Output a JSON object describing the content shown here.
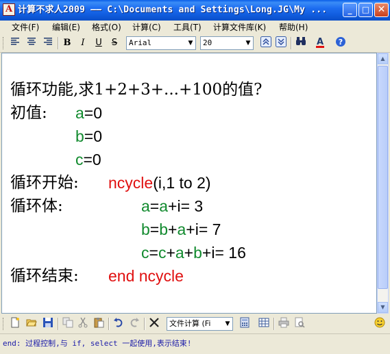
{
  "window": {
    "title": "计算不求人2009 —— C:\\Documents and Settings\\Long.JG\\My ...",
    "icon_letter": "A",
    "minimize": "_",
    "maximize": "□",
    "close": "✕"
  },
  "menu": [
    "文件(F)",
    "编辑(E)",
    "格式(O)",
    "计算(C)",
    "工具(T)",
    "计算文件库(K)",
    "帮助(H)"
  ],
  "toolbar": {
    "bold": "B",
    "italic": "I",
    "underline": "U",
    "strike": "S",
    "font": "Arial",
    "size": "20"
  },
  "document": {
    "l1": "循环功能,求1+2+3+...+100的值?",
    "l2_label": "初值:",
    "a": "a",
    "b": "b",
    "c": "c",
    "i": "i",
    "eq0": "=0",
    "l5_label": "循环开始:",
    "ncycle": "ncycle",
    "ncycle_args": "(i,1 to 2)",
    "l6_label": "循环体:",
    "eq": "=",
    "plus": "+",
    "eqsp": "= ",
    "r1": "3",
    "r2": "7",
    "r3": "16",
    "l9_label": "循环结束:",
    "end_ncycle": "end ncycle"
  },
  "bottom": {
    "mode": "文件计算 (Fi"
  },
  "status": "end: 过程控制,与 if, select 一起使用,表示结束!",
  "icons": [
    "align-left-icon",
    "align-center-icon",
    "align-right-icon",
    "new-file-icon",
    "open-folder-icon",
    "save-icon",
    "copy-icon",
    "cut-icon",
    "paste-icon",
    "undo-icon",
    "redo-icon",
    "calculator-icon",
    "binoculars-icon",
    "help-icon"
  ]
}
